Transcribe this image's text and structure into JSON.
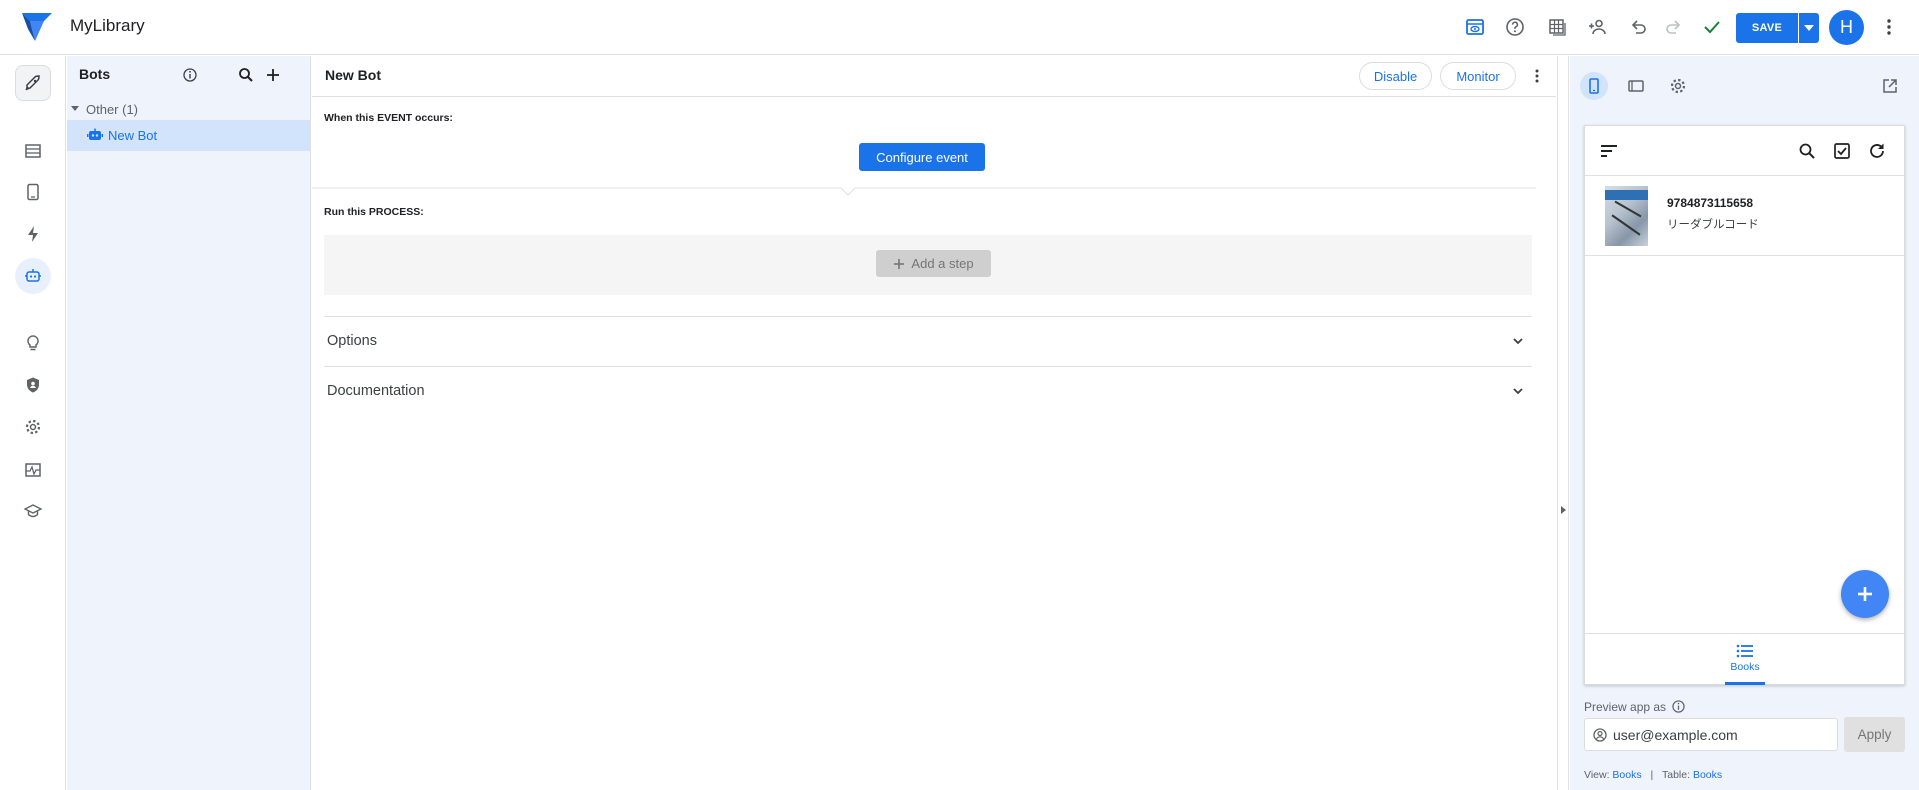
{
  "app": {
    "title": "MyLibrary"
  },
  "toolbar": {
    "save_label": "SAVE",
    "avatar_initial": "H",
    "icons": [
      "preview-icon",
      "help-icon",
      "table-icon",
      "share-icon",
      "undo-icon",
      "redo-icon",
      "check-icon",
      "more-icon"
    ]
  },
  "leftnav": {
    "items": [
      "launch-icon",
      "data-icon",
      "views-icon",
      "actions-icon",
      "bots-icon",
      "ideas-icon",
      "security-icon",
      "settings-icon",
      "monitor-icon",
      "learn-icon"
    ],
    "active": "bots-icon"
  },
  "bots_panel": {
    "title": "Bots",
    "group_label": "Other (1)",
    "item_label": "New Bot"
  },
  "editor": {
    "title": "New Bot",
    "disable_label": "Disable",
    "monitor_label": "Monitor",
    "event_label": "When this EVENT occurs:",
    "configure_label": "Configure event",
    "process_label": "Run this PROCESS:",
    "add_step_label": "Add a step",
    "options_label": "Options",
    "documentation_label": "Documentation"
  },
  "preview": {
    "book": {
      "isbn": "9784873115658",
      "title": "リーダブルコード"
    },
    "nav_label": "Books",
    "preview_as_label": "Preview app as",
    "user_value": "user@example.com",
    "apply_label": "Apply",
    "footer": {
      "view_prefix": "View:",
      "view_value": "Books",
      "sep": "|",
      "table_prefix": "Table:",
      "table_value": "Books"
    }
  },
  "colors": {
    "accent": "#1a73e8",
    "panel_bg": "#eef3fc",
    "selected_bg": "#d2e3fc",
    "success": "#188038"
  }
}
